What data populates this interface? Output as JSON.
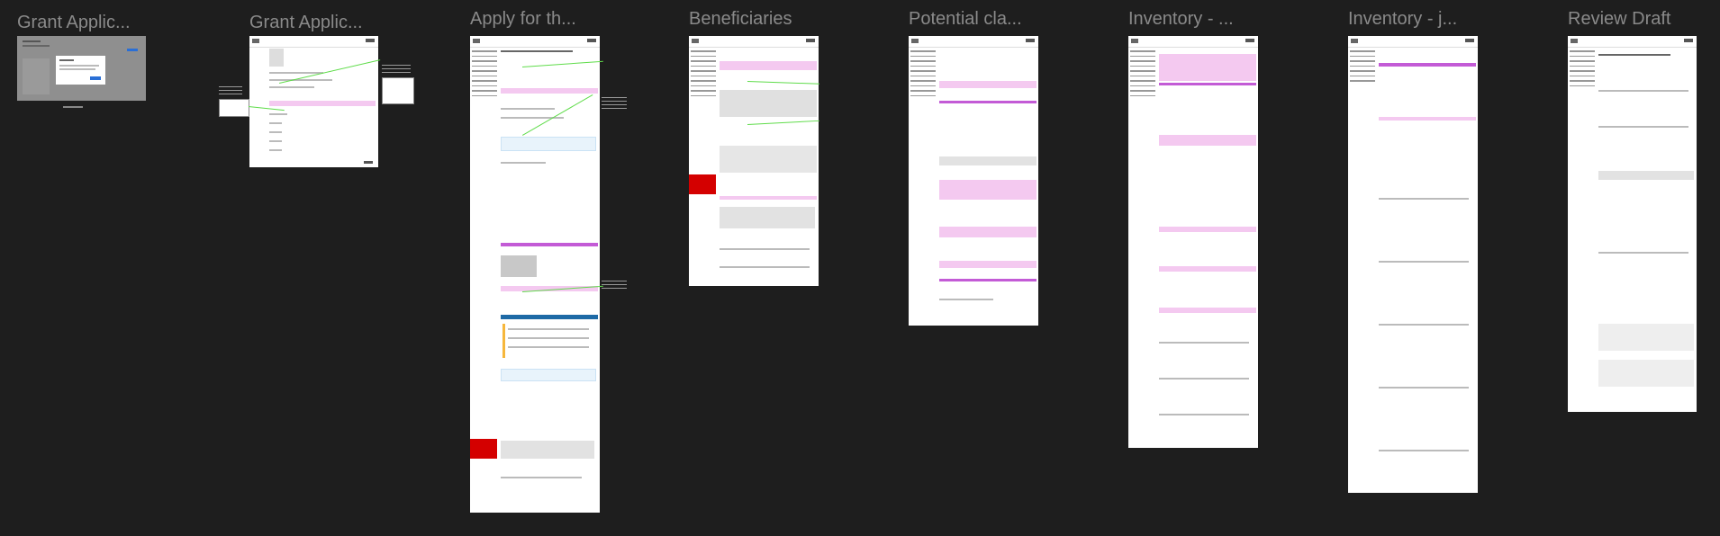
{
  "canvas": {
    "background": "#1e1e1e",
    "title_color": "#8a8a8a",
    "annotation_color": "#5fdc4a",
    "highlight_pink": "#f4c9f0",
    "highlight_magenta": "#c35bd6",
    "alert_red": "#d40000"
  },
  "frames": [
    {
      "title": "Grant Applic...",
      "icon": "frame-thumbnail"
    },
    {
      "title": "Grant Applic...",
      "icon": "frame-thumbnail"
    },
    {
      "title": "Apply for th...",
      "icon": "frame-thumbnail"
    },
    {
      "title": "Beneficiaries",
      "icon": "frame-thumbnail"
    },
    {
      "title": "Potential cla...",
      "icon": "frame-thumbnail"
    },
    {
      "title": "Inventory - ...",
      "icon": "frame-thumbnail"
    },
    {
      "title": "Inventory - j...",
      "icon": "frame-thumbnail"
    },
    {
      "title": "Review Draft",
      "icon": "frame-thumbnail"
    }
  ]
}
